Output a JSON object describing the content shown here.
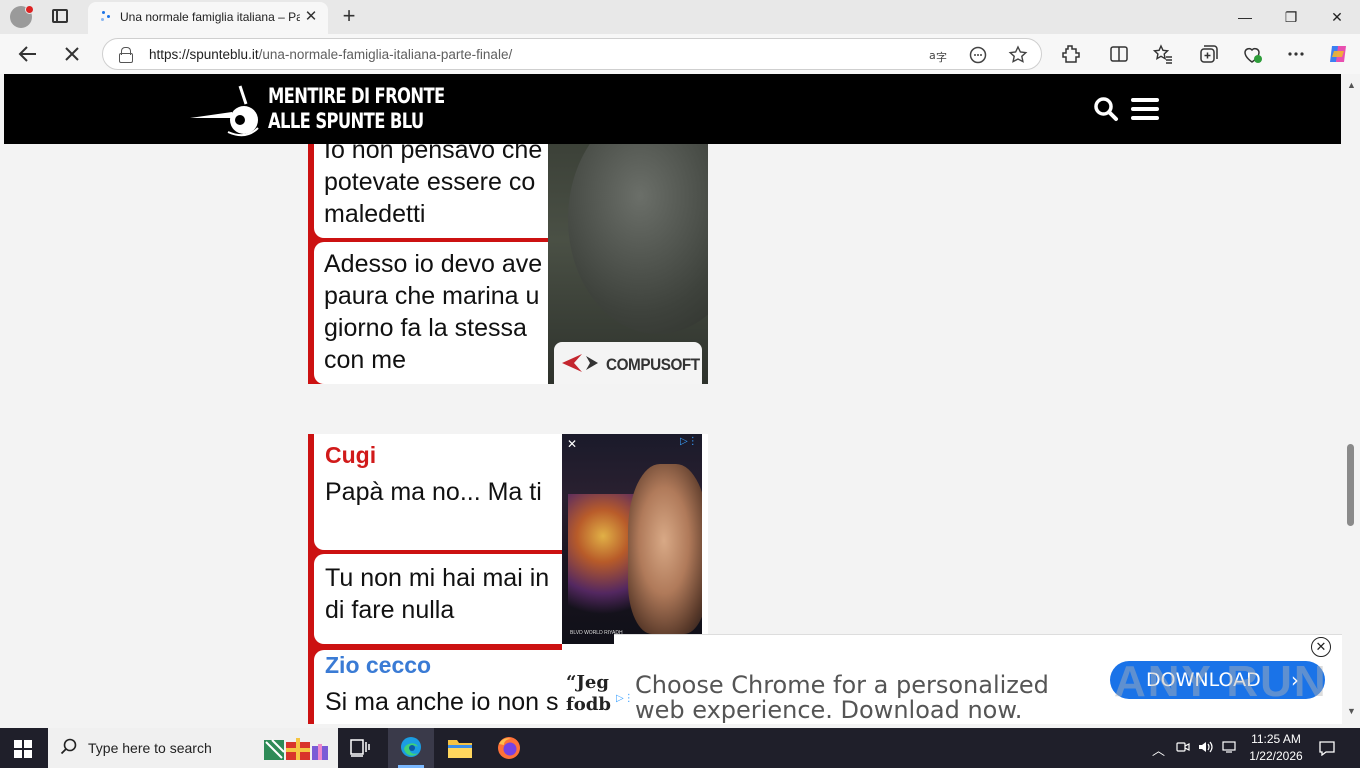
{
  "browser": {
    "tab": {
      "title": "Una normale famiglia italiana – Parte finale"
    },
    "new_tab_label": "+",
    "window": {
      "minimize": "—",
      "restore": "❐",
      "close": "✕"
    },
    "address": {
      "domain": "https://spunteblu.it",
      "path": "/una-normale-famiglia-italiana-parte-finale/"
    }
  },
  "site": {
    "logo_line1": "MENTIRE DI FRONTE",
    "logo_line2": "ALLE SPUNTE BLU"
  },
  "chat1": {
    "message1": "Io non pensavo che\npotevate essere co\nmaledetti",
    "message2": "Adesso io devo ave\npaura che marina u\ngiorno fa la stessa\ncon me"
  },
  "ad1": {
    "brand": "COMPUSOFT"
  },
  "chat2": {
    "sender1": "Cugi",
    "sender1_color": "#d11a1a",
    "message1": "Papà ma no... Ma ti",
    "message2": "Tu non mi hai mai in\ndi fare nulla",
    "sender2": "Zio cecco",
    "sender2_color": "#3a7bd5",
    "message3": "Si ma anche io non s"
  },
  "ad2": {
    "close": "✕",
    "caption": "BLVD WORLD RIYADH",
    "quote": "“Jeg\nfodb"
  },
  "bottom_ad": {
    "text": "Choose Chrome for a personalized\nweb experience. Download now.",
    "button": "DOWNLOAD",
    "close": "✕",
    "watermark": "ANY RUN"
  },
  "taskbar": {
    "search_placeholder": "Type here to search",
    "time": "11:25 AM",
    "date": "1/22/2026"
  }
}
